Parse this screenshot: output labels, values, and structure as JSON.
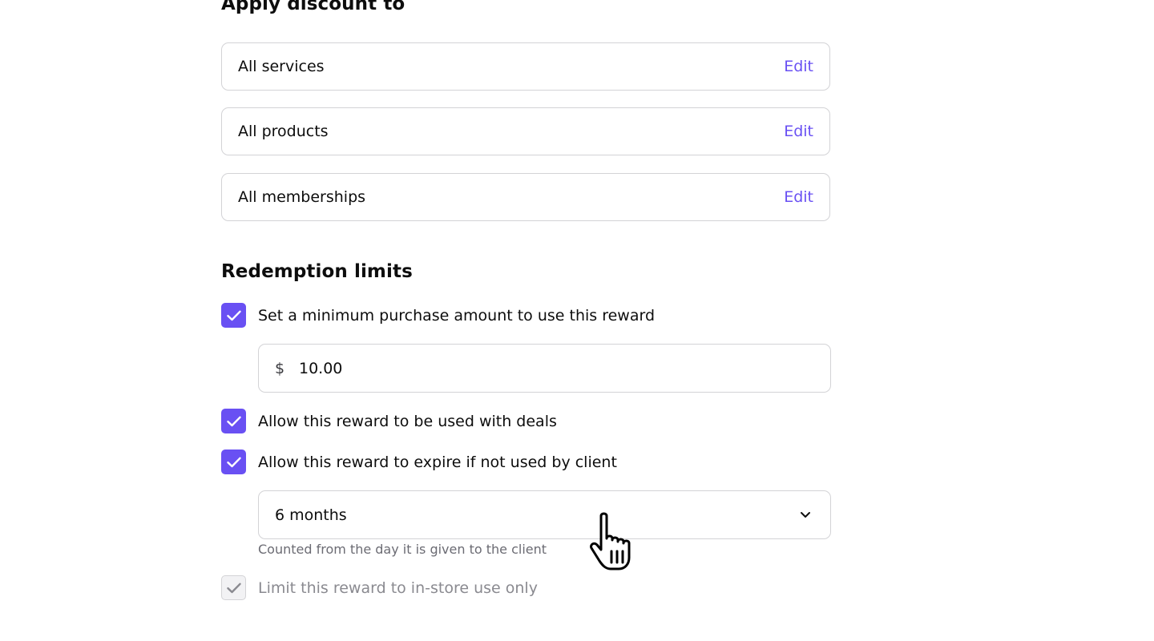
{
  "apply_section": {
    "title": "Apply discount to",
    "rows": [
      {
        "label": "All services",
        "action": "Edit"
      },
      {
        "label": "All products",
        "action": "Edit"
      },
      {
        "label": "All memberships",
        "action": "Edit"
      }
    ]
  },
  "redemption_section": {
    "title": "Redemption limits",
    "min_purchase": {
      "label": "Set a minimum purchase amount to use this reward",
      "checked": true,
      "currency_symbol": "$",
      "amount": "10.00"
    },
    "allow_with_deals": {
      "label": "Allow this reward to be used with deals",
      "checked": true
    },
    "allow_expire": {
      "label": "Allow this reward to expire if not used by client",
      "checked": true,
      "select_value": "6 months",
      "helper": "Counted from the day it is given to the client"
    },
    "limit_in_store": {
      "label": "Limit this reward to in-store use only",
      "checked": true,
      "disabled": true
    }
  },
  "colors": {
    "accent": "#6950f3",
    "border": "#d3d3d6",
    "muted_text": "#6b6b73",
    "disabled_text": "#8a8a90"
  },
  "icons": {
    "checkbox": "check-icon",
    "select": "chevron-down-icon",
    "cursor": "hand-pointer-cursor"
  }
}
